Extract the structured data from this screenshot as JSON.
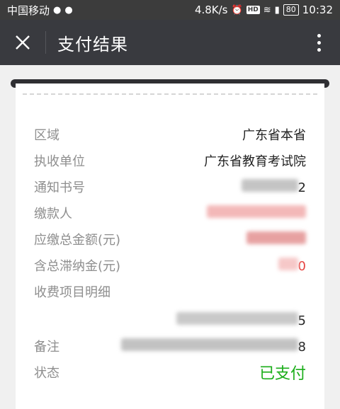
{
  "status_bar": {
    "carrier": "中国移动",
    "speed": "4.8K/s",
    "battery": "80",
    "time": "10:32"
  },
  "nav": {
    "close_icon": "close-icon",
    "title": "支付结果",
    "more_icon": "more-vertical-icon"
  },
  "rows": {
    "region": {
      "label": "区域",
      "value": "广东省本省"
    },
    "collector": {
      "label": "执收单位",
      "value": "广东省教育考试院"
    },
    "notice_no": {
      "label": "通知书号",
      "value": "2"
    },
    "payer": {
      "label": "缴款人"
    },
    "total_amount": {
      "label": "应缴总金额(元)"
    },
    "late_fee": {
      "label": "含总滞纳金(元)",
      "value": "0"
    },
    "items_detail": {
      "label": "收费项目明细",
      "value": "5"
    },
    "remark": {
      "label": "备注",
      "value": "8"
    },
    "status": {
      "label": "状态",
      "value": "已支付"
    }
  },
  "colors": {
    "nav_bg": "#393a3f",
    "status_paid": "#1aad19",
    "highlight_red": "#e64340"
  }
}
